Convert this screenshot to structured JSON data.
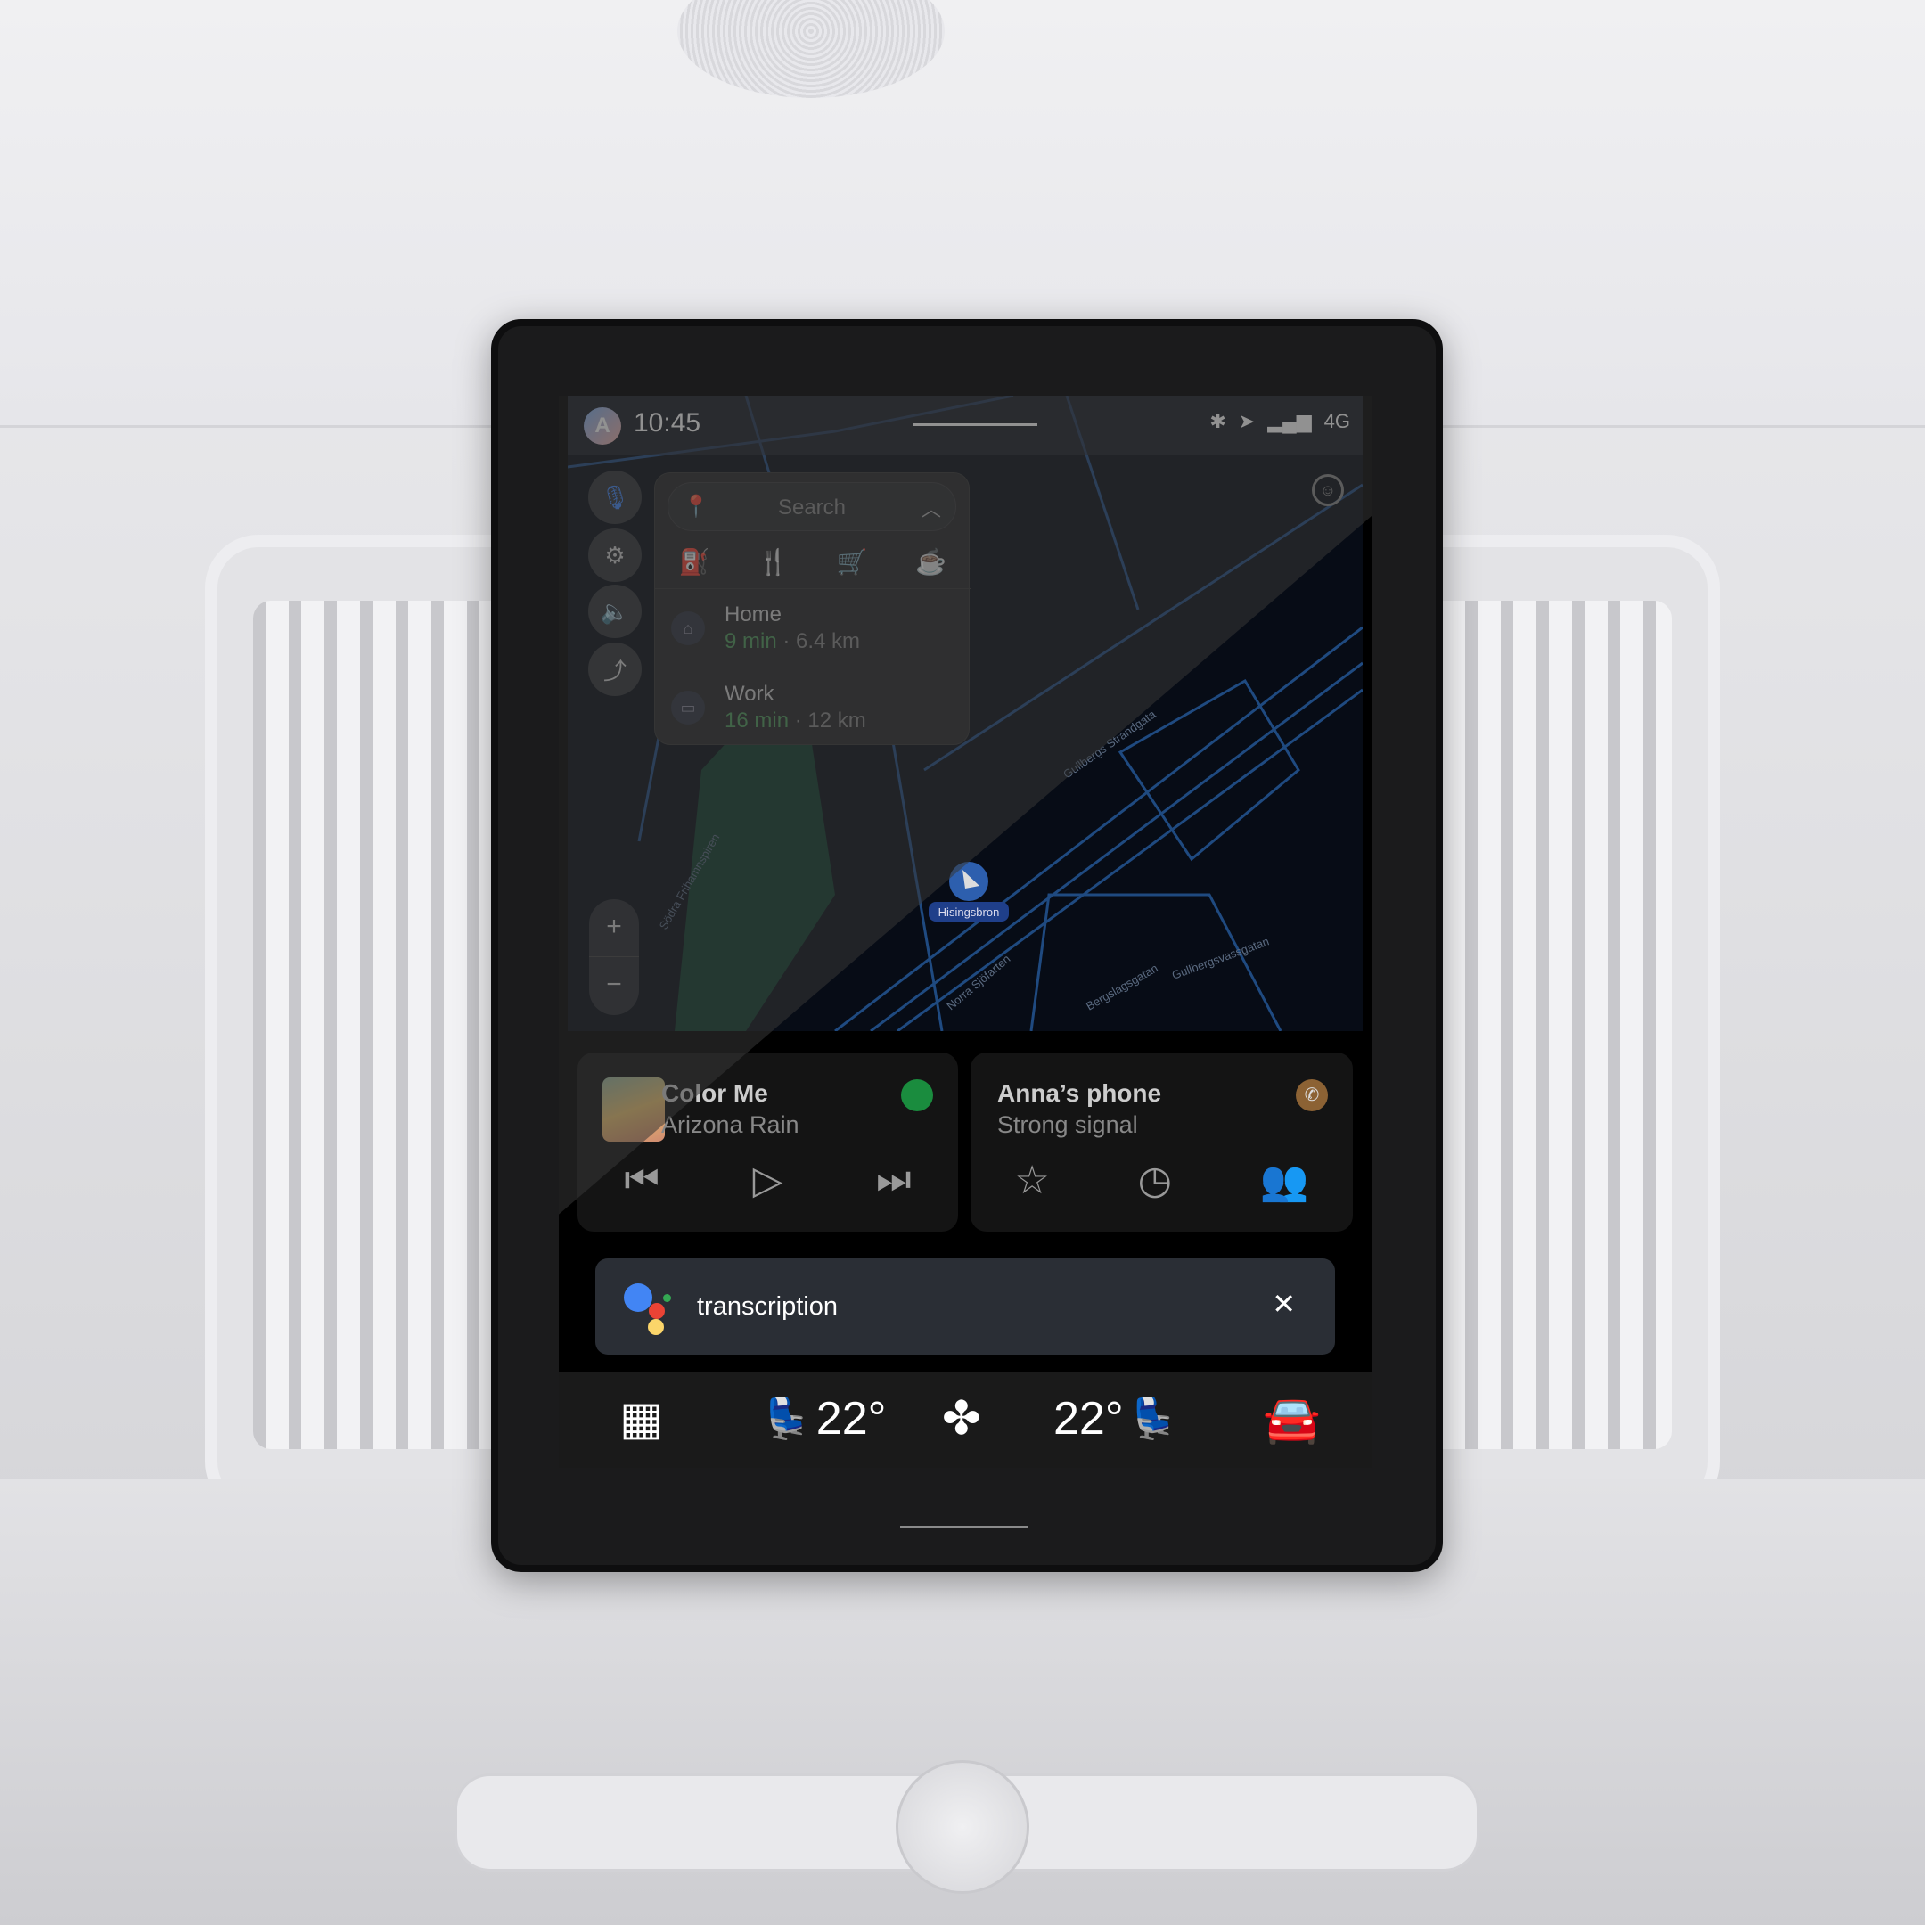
{
  "status": {
    "avatar_letter": "A",
    "time": "10:45",
    "network": "4G",
    "icons": [
      "bluetooth-icon",
      "location-arrow-icon",
      "signal-icon"
    ]
  },
  "rail": {
    "icons": [
      "microphone-icon",
      "gear-icon",
      "volume-icon",
      "route-icon"
    ]
  },
  "search": {
    "placeholder": "Search",
    "categories": [
      "ev-charging-icon",
      "restaurant-icon",
      "shopping-cart-icon",
      "coffee-icon"
    ]
  },
  "destinations": [
    {
      "name": "Home",
      "eta": "9 min",
      "distance": "· 6.4 km",
      "icon": "home-icon"
    },
    {
      "name": "Work",
      "eta": "16 min",
      "distance": "· 12 km",
      "icon": "briefcase-icon"
    }
  ],
  "map": {
    "location_label": "Hisingsbron",
    "streets": [
      "Gullbergs Strandgata",
      "Norra Sjöfarten",
      "Bergslagsgatan",
      "Gullbergsvassgatan",
      "Södra Frihamnspiren"
    ],
    "zoom_in": "+",
    "zoom_out": "−"
  },
  "media": {
    "title": "Color Me",
    "artist": "Arizona Rain",
    "app_color": "#1db954"
  },
  "phone": {
    "title": "Anna’s phone",
    "status": "Strong signal",
    "accent": "#a8733c"
  },
  "assistant": {
    "text": "transcription",
    "close": "✕"
  },
  "climate": {
    "driver_temp": "22°",
    "passenger_temp": "22°"
  },
  "colors": {
    "map_bg": "#070c16",
    "road": "#1f4a80",
    "eta_green": "#4f9a5c"
  }
}
